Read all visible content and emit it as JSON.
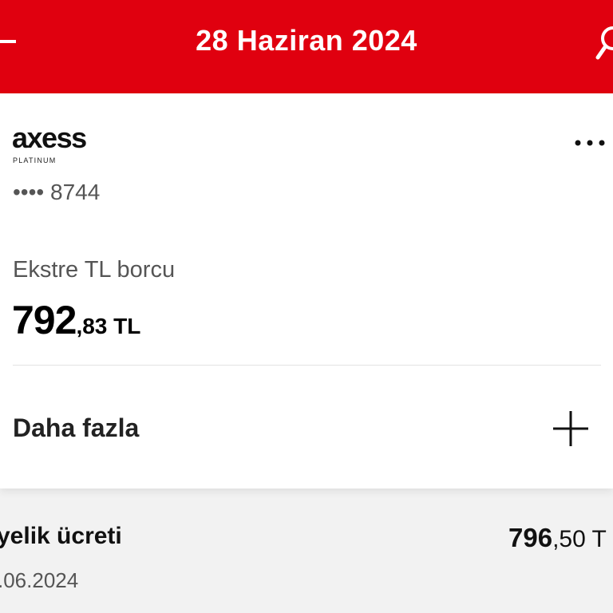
{
  "header": {
    "title": "28 Haziran 2024",
    "back_icon": "back-arrow-icon",
    "search_icon": "search-icon",
    "color": "#e0000f"
  },
  "card": {
    "brand": "axess",
    "tier": "PLATINUM",
    "number": "•••• 8744",
    "menu_icon": "more-horizontal-icon",
    "statement_label": "Ekstre TL borcu",
    "amount_int": "792",
    "amount_frac": ",83 TL",
    "more_label": "Daha fazla",
    "more_icon": "plus-icon"
  },
  "transactions": [
    {
      "description": "yelik ücreti",
      "date": ".06.2024",
      "amount_int": "796",
      "amount_frac": ",50 T"
    }
  ]
}
